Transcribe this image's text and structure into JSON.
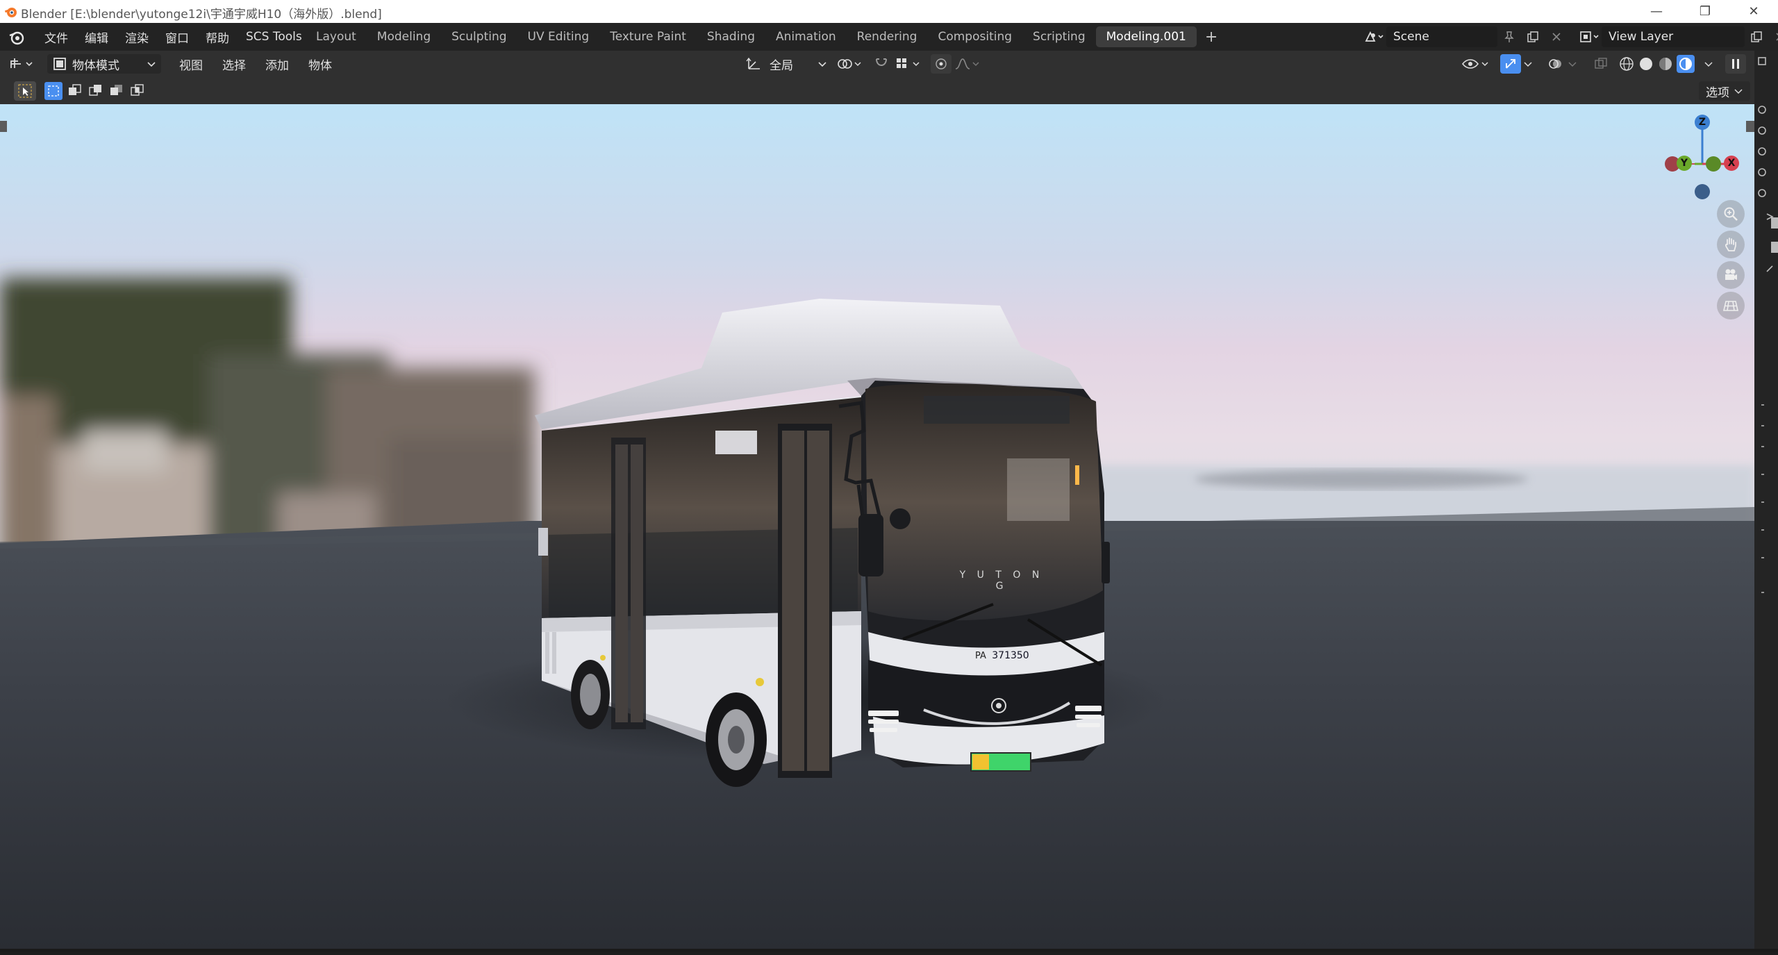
{
  "window": {
    "title": "Blender [E:\\blender\\yutonge12i\\宇通宇威H10（海外版）.blend]"
  },
  "menu": [
    "文件",
    "编辑",
    "渲染",
    "窗口",
    "帮助",
    "SCS Tools"
  ],
  "workspace_tabs": [
    "Layout",
    "Modeling",
    "Sculpting",
    "UV Editing",
    "Texture Paint",
    "Shading",
    "Animation",
    "Rendering",
    "Compositing",
    "Scripting",
    "Modeling.001"
  ],
  "active_tab": "Modeling.001",
  "scene": {
    "name": "Scene"
  },
  "view_layer": {
    "name": "View Layer"
  },
  "viewport_header": {
    "mode": "物体模式",
    "menus": [
      "视图",
      "选择",
      "添加",
      "物体"
    ],
    "transform_orientation": "全局",
    "options_label": "选项"
  },
  "gizmo": {
    "z": "Z",
    "y": "Y",
    "x": "X"
  },
  "bus": {
    "brand": "Y U T O N G",
    "plate_prefix": "PA",
    "plate_number": "371350"
  },
  "colors": {
    "header_bg": "#303030",
    "topbar_bg": "#232323",
    "active_tab_bg": "#3d3d3d",
    "accent_blue": "#4a8ff0",
    "axis_x": "#d6404f",
    "axis_y": "#6aa92a",
    "axis_z": "#3b7fd1",
    "plate_green": "#3fd46a",
    "plate_yellow": "#f2c230"
  },
  "icons": [
    "blender-logo-icon",
    "editor-type-icon",
    "object-mode-icon",
    "select-box-icon",
    "transform-orientation-icon",
    "snap-icon",
    "proportional-edit-icon",
    "zoom-icon",
    "hand-pan-icon",
    "camera-icon",
    "grid-icon",
    "overlay-icon",
    "shading-wireframe-icon",
    "shading-solid-icon",
    "shading-material-icon",
    "shading-rendered-icon"
  ]
}
